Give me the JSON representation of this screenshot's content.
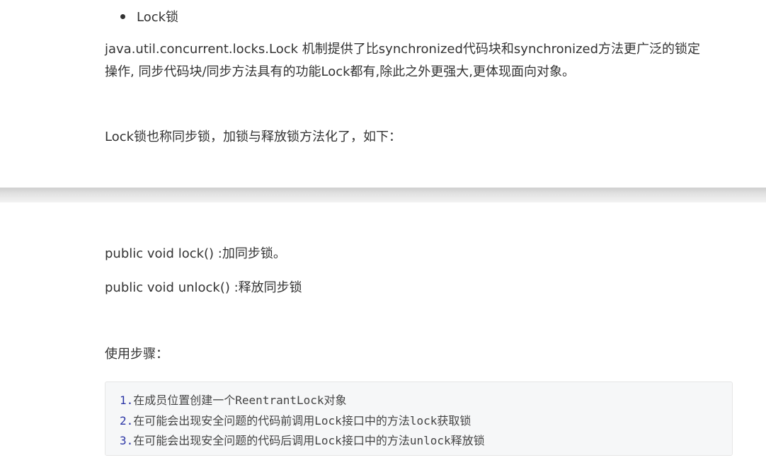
{
  "bullet": {
    "label": "Lock锁"
  },
  "paragraphs": {
    "intro_line1": "java.util.concurrent.locks.Lock 机制提供了比synchronized代码块和synchronized方法更广泛的锁定",
    "intro_line2": "操作, 同步代码块/同步方法具有的功能Lock都有,除此之外更强大,更体现面向对象。",
    "also_called": "Lock锁也称同步锁，加锁与释放锁方法化了，如下：",
    "lock_method": "public void lock() :加同步锁。",
    "unlock_method": "public void unlock() :释放同步锁",
    "steps_title": "使用步骤："
  },
  "code": {
    "lines": [
      {
        "num": "1.",
        "pre": "在成员位置创建一个",
        "mono": "ReentrantLock",
        "post": "对象"
      },
      {
        "num": "2.",
        "pre": "在可能会出现安全问题的代码前调用",
        "mono": "Lock",
        "mid": "接口中的方法",
        "mono2": "lock",
        "post": "获取锁"
      },
      {
        "num": "3.",
        "pre": "在可能会出现安全问题的代码后调用",
        "mono": "Lock",
        "mid": "接口中的方法",
        "mono2": "unlock",
        "post": "释放锁"
      }
    ]
  }
}
